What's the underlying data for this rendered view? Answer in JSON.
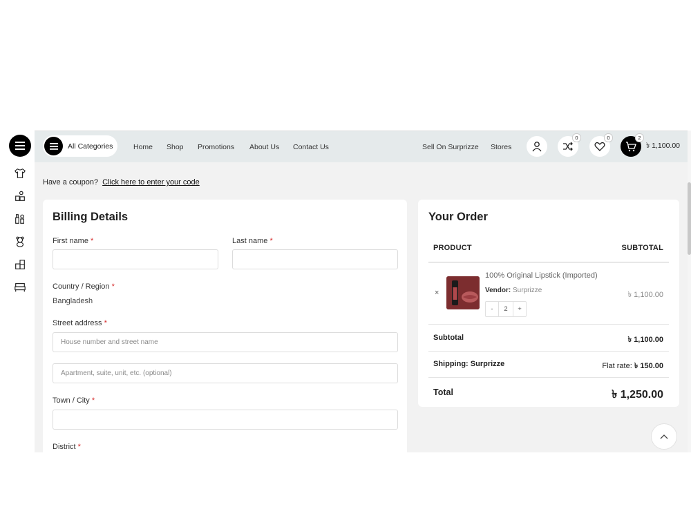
{
  "header": {
    "all_categories_label": "All Categories",
    "nav": [
      "Home",
      "Shop",
      "Promotions",
      "About Us",
      "Contact Us"
    ],
    "sell_label": "Sell On Surprizze",
    "stores_label": "Stores",
    "compare_count": "0",
    "wishlist_count": "0",
    "cart_count": "2",
    "cart_total": "৳ 1,100.00"
  },
  "rail_icons": [
    "tshirt-icon",
    "toys-icon",
    "cosmetics-icon",
    "teddy-bear-icon",
    "furniture-icon",
    "bed-icon"
  ],
  "coupon": {
    "text": "Have a coupon?",
    "link": "Click here to enter your code"
  },
  "billing": {
    "title": "Billing Details",
    "first_name_label": "First name",
    "last_name_label": "Last name",
    "country_label": "Country / Region",
    "country_value": "Bangladesh",
    "street_label": "Street address",
    "street_placeholder_1": "House number and street name",
    "street_placeholder_2": "Apartment, suite, unit, etc. (optional)",
    "city_label": "Town / City",
    "district_label": "District",
    "required_mark": "*"
  },
  "order": {
    "title": "Your Order",
    "col_product": "PRODUCT",
    "col_subtotal": "SUBTOTAL",
    "item": {
      "remove": "×",
      "name": "100% Original Lipstick (Imported)",
      "vendor_label": "Vendor:",
      "vendor_name": "Surprizze",
      "qty_minus": "-",
      "qty": "2",
      "qty_plus": "+",
      "price": "৳ 1,100.00"
    },
    "subtotal_label": "Subtotal",
    "subtotal_value": "৳ 1,100.00",
    "shipping_label": "Shipping: Surprizze",
    "shipping_prefix": "Flat rate:",
    "shipping_value": "৳ 150.00",
    "total_label": "Total",
    "total_value": "৳ 1,250.00"
  },
  "colors": {
    "header_bg": "#e5eaeb",
    "content_bg": "#f2f2f2",
    "required": "#d62b2b",
    "thumb": "#7c2d2f"
  }
}
